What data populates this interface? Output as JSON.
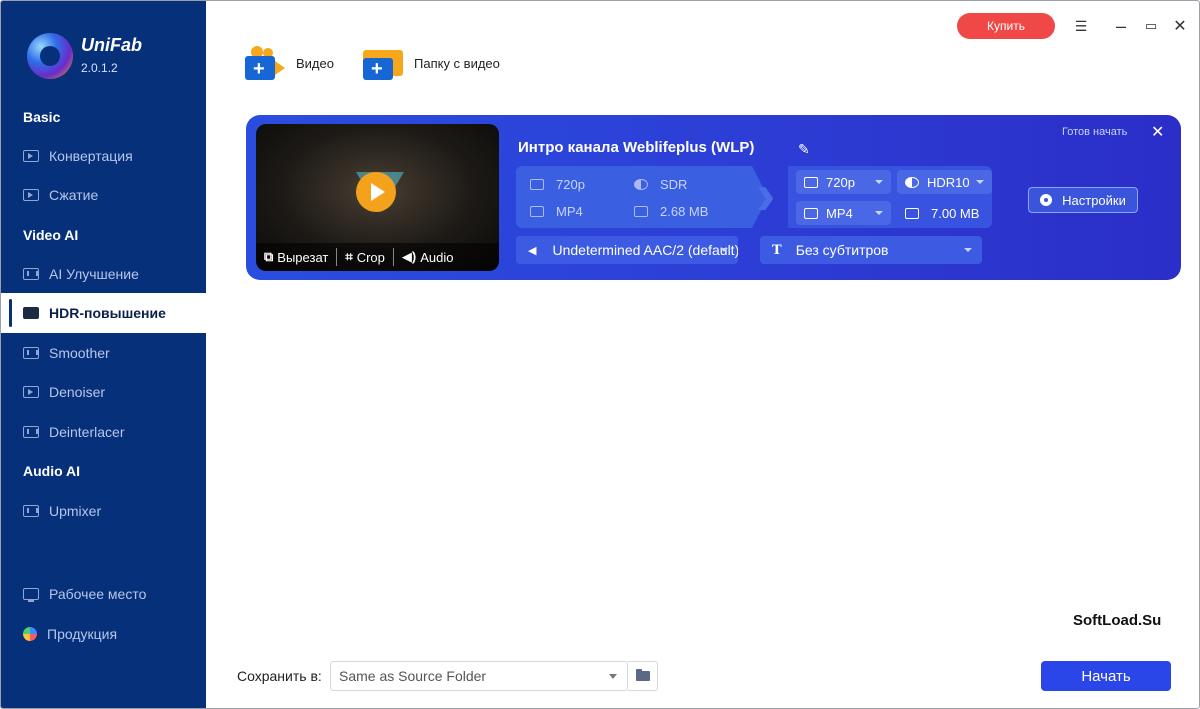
{
  "app": {
    "name": "UniFab",
    "version": "2.0.1.2"
  },
  "sidebar": {
    "sections": [
      {
        "title": "Basic",
        "items": [
          {
            "label": "Конвертация",
            "icon": "play-icon"
          },
          {
            "label": "Сжатие",
            "icon": "compress-icon"
          }
        ]
      },
      {
        "title": "Video AI",
        "items": [
          {
            "label": "AI Улучшение",
            "icon": "upscale-icon"
          },
          {
            "label": "HDR-повышение",
            "icon": "hdr-icon",
            "active": true
          },
          {
            "label": "Smoother",
            "icon": "smoother-icon"
          },
          {
            "label": "Denoiser",
            "icon": "denoiser-icon"
          },
          {
            "label": "Deinterlacer",
            "icon": "deinterlacer-icon"
          }
        ]
      },
      {
        "title": "Audio AI",
        "items": [
          {
            "label": "Upmixer",
            "icon": "upmixer-icon"
          }
        ]
      }
    ],
    "footer": [
      {
        "label": "Рабочее место",
        "icon": "monitor-icon"
      },
      {
        "label": "Продукция",
        "icon": "globe-icon"
      }
    ]
  },
  "topbar": {
    "buy_label": "Купить"
  },
  "toolbar": {
    "add_video_label": "Видео",
    "add_folder_label": "Папку с видео"
  },
  "task": {
    "title": "Интро канала Weblifeplus (WLP)",
    "status": "Готов начать",
    "thumb_actions": {
      "trim": "Вырезат",
      "crop": "Crop",
      "audio": "Audio"
    },
    "source": {
      "resolution": "720p",
      "dynamic_range": "SDR",
      "format": "MP4",
      "size": "2.68 MB"
    },
    "output": {
      "resolution": "720p",
      "dynamic_range": "HDR10",
      "format": "MP4",
      "size": "7.00 MB"
    },
    "settings_label": "Настройки",
    "audio_track": "Undetermined AAC/2 (default)",
    "subtitles": "Без субтитров"
  },
  "bottom": {
    "save_label": "Сохранить в:",
    "save_path": "Same as Source Folder",
    "start_label": "Начать",
    "watermark": "SoftLoad.Su"
  },
  "colors": {
    "sidebar": "#07307a",
    "card": "#2a45e0",
    "buy": "#f04747",
    "start": "#2a45e8"
  }
}
